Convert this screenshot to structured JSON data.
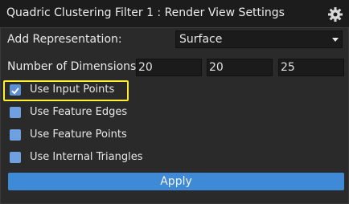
{
  "window": {
    "title": "Quadric Clustering Filter 1 : Render View Settings",
    "settings_icon": "gear-icon"
  },
  "representation": {
    "label": "Add Representation:",
    "selected": "Surface"
  },
  "dimensions": {
    "label": "Number of Dimensions :",
    "values": [
      "20",
      "20",
      "25"
    ]
  },
  "checkboxes": [
    {
      "label": "Use Input Points",
      "checked": true
    },
    {
      "label": "Use Feature Edges",
      "checked": false
    },
    {
      "label": "Use Feature Points",
      "checked": false
    },
    {
      "label": "Use Internal Triangles",
      "checked": false
    }
  ],
  "apply": {
    "label": "Apply"
  },
  "colors": {
    "accent": "#3f8ad6",
    "highlight": "#ffef2e",
    "background": "#2a2a2a"
  }
}
